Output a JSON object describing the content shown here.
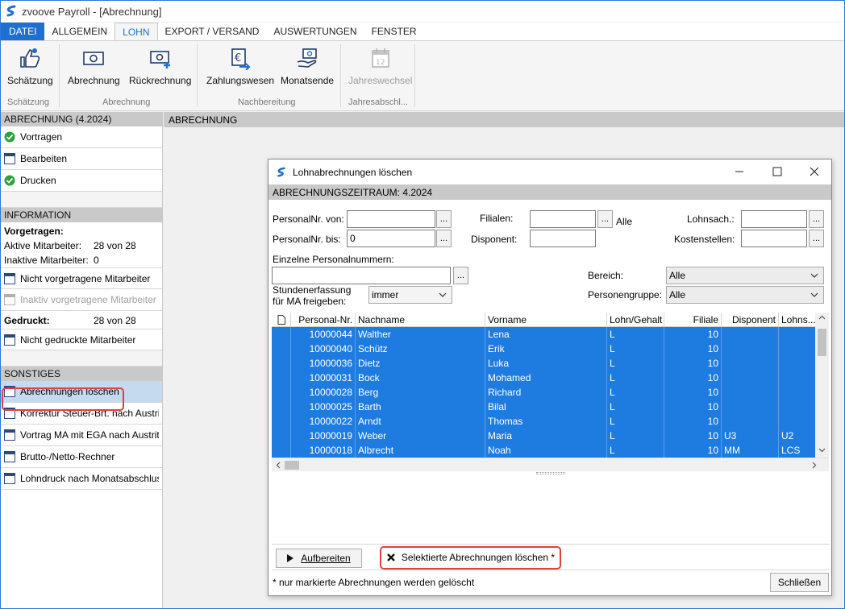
{
  "window": {
    "title": "zvoove Payroll - [Abrechnung]"
  },
  "menu_tabs": [
    "DATEI",
    "ALLGEMEIN",
    "LOHN",
    "EXPORT / VERSAND",
    "AUSWERTUNGEN",
    "FENSTER"
  ],
  "ribbon": {
    "buttons": [
      "Schätzung",
      "Abrechnung",
      "Rückrechnung",
      "Zahlungswesen",
      "Monatsende",
      "Jahreswechsel"
    ],
    "groups": [
      "Schätzung",
      "Abrechnung",
      "Nachbereitung",
      "Jahresabschl..."
    ]
  },
  "left": {
    "section_abrechnung": "ABRECHNUNG (4.2024)",
    "abrechnung_items": [
      "Vortragen",
      "Bearbeiten",
      "Drucken"
    ],
    "section_information": "INFORMATION",
    "vorgetragen_label": "Vorgetragen:",
    "aktive_label": "Aktive Mitarbeiter:",
    "aktive_value": "28 von 28",
    "inaktive_label": "Inaktive Mitarbeiter:",
    "inaktive_value": "0",
    "nicht_vorgetragen": "Nicht vorgetragene Mitarbeiter",
    "inaktiv_vorgetragen": "Inaktiv vorgetragene Mitarbeiter",
    "gedruckt_label": "Gedruckt:",
    "gedruckt_value": "28 von 28",
    "nicht_gedruckt": "Nicht gedruckte Mitarbeiter",
    "section_sonstiges": "SONSTIGES",
    "sonstiges_items": [
      "Abrechnungen löschen",
      "Korrektur Steuer-Brt. nach Austritt",
      "Vortrag MA mit EGA nach Austritt",
      "Brutto-/Netto-Rechner",
      "Lohndruck nach Monatsabschluss"
    ]
  },
  "main": {
    "header": "ABRECHNUNG"
  },
  "dialog": {
    "title": "Lohnabrechnungen löschen",
    "subheader": "ABRECHNUNGSZEITRAUM: 4.2024",
    "personalnr_von_label": "PersonalNr. von:",
    "personalnr_von_value": "",
    "personalnr_bis_label": "PersonalNr. bis:",
    "personalnr_bis_value": "0",
    "filialen_label": "Filialen:",
    "filialen_value": "",
    "filialen_alle": "Alle",
    "disponent_label": "Disponent:",
    "disponent_value": "",
    "lohnsach_label": "Lohnsach.:",
    "lohnsach_value": "",
    "kostenstellen_label": "Kostenstellen:",
    "kostenstellen_value": "",
    "einzelne_label": "Einzelne Personalnummern:",
    "einzelne_value": "",
    "bereich_label": "Bereich:",
    "bereich_value": "Alle",
    "personengruppe_label": "Personengruppe:",
    "personengruppe_value": "Alle",
    "stunden_label_1": "Stundenerfassung",
    "stunden_label_2": "für MA freigeben:",
    "stunden_value": "immer",
    "browse": "...",
    "table": {
      "columns": [
        "Personal-Nr.",
        "Nachname",
        "Vorname",
        "Lohn/Gehalt",
        "Filiale",
        "Disponent",
        "Lohns..."
      ],
      "rows": [
        [
          "10000044",
          "Walther",
          "Lena",
          "L",
          "10",
          "",
          ""
        ],
        [
          "10000040",
          "Schütz",
          "Erik",
          "L",
          "10",
          "",
          ""
        ],
        [
          "10000036",
          "Dietz",
          "Luka",
          "L",
          "10",
          "",
          ""
        ],
        [
          "10000031",
          "Bock",
          "Mohamed",
          "L",
          "10",
          "",
          ""
        ],
        [
          "10000028",
          "Berg",
          "Richard",
          "L",
          "10",
          "",
          ""
        ],
        [
          "10000025",
          "Barth",
          "Bilal",
          "L",
          "10",
          "",
          ""
        ],
        [
          "10000022",
          "Arndt",
          "Thomas",
          "L",
          "10",
          "",
          ""
        ],
        [
          "10000019",
          "Weber",
          "Maria",
          "L",
          "10",
          "U3",
          "U2"
        ],
        [
          "10000018",
          "Albrecht",
          "Noah",
          "L",
          "10",
          "MM",
          "LCS"
        ]
      ]
    },
    "aufbereiten": "Aufbereiten",
    "loeschen": "Selektierte Abrechnungen löschen *",
    "footnote": "* nur markierte Abrechnungen werden gelöscht",
    "schliessen": "Schließen"
  },
  "colors": {
    "accent": "#1e6fd0",
    "selection": "#1e7be0",
    "highlight": "#e04040"
  }
}
